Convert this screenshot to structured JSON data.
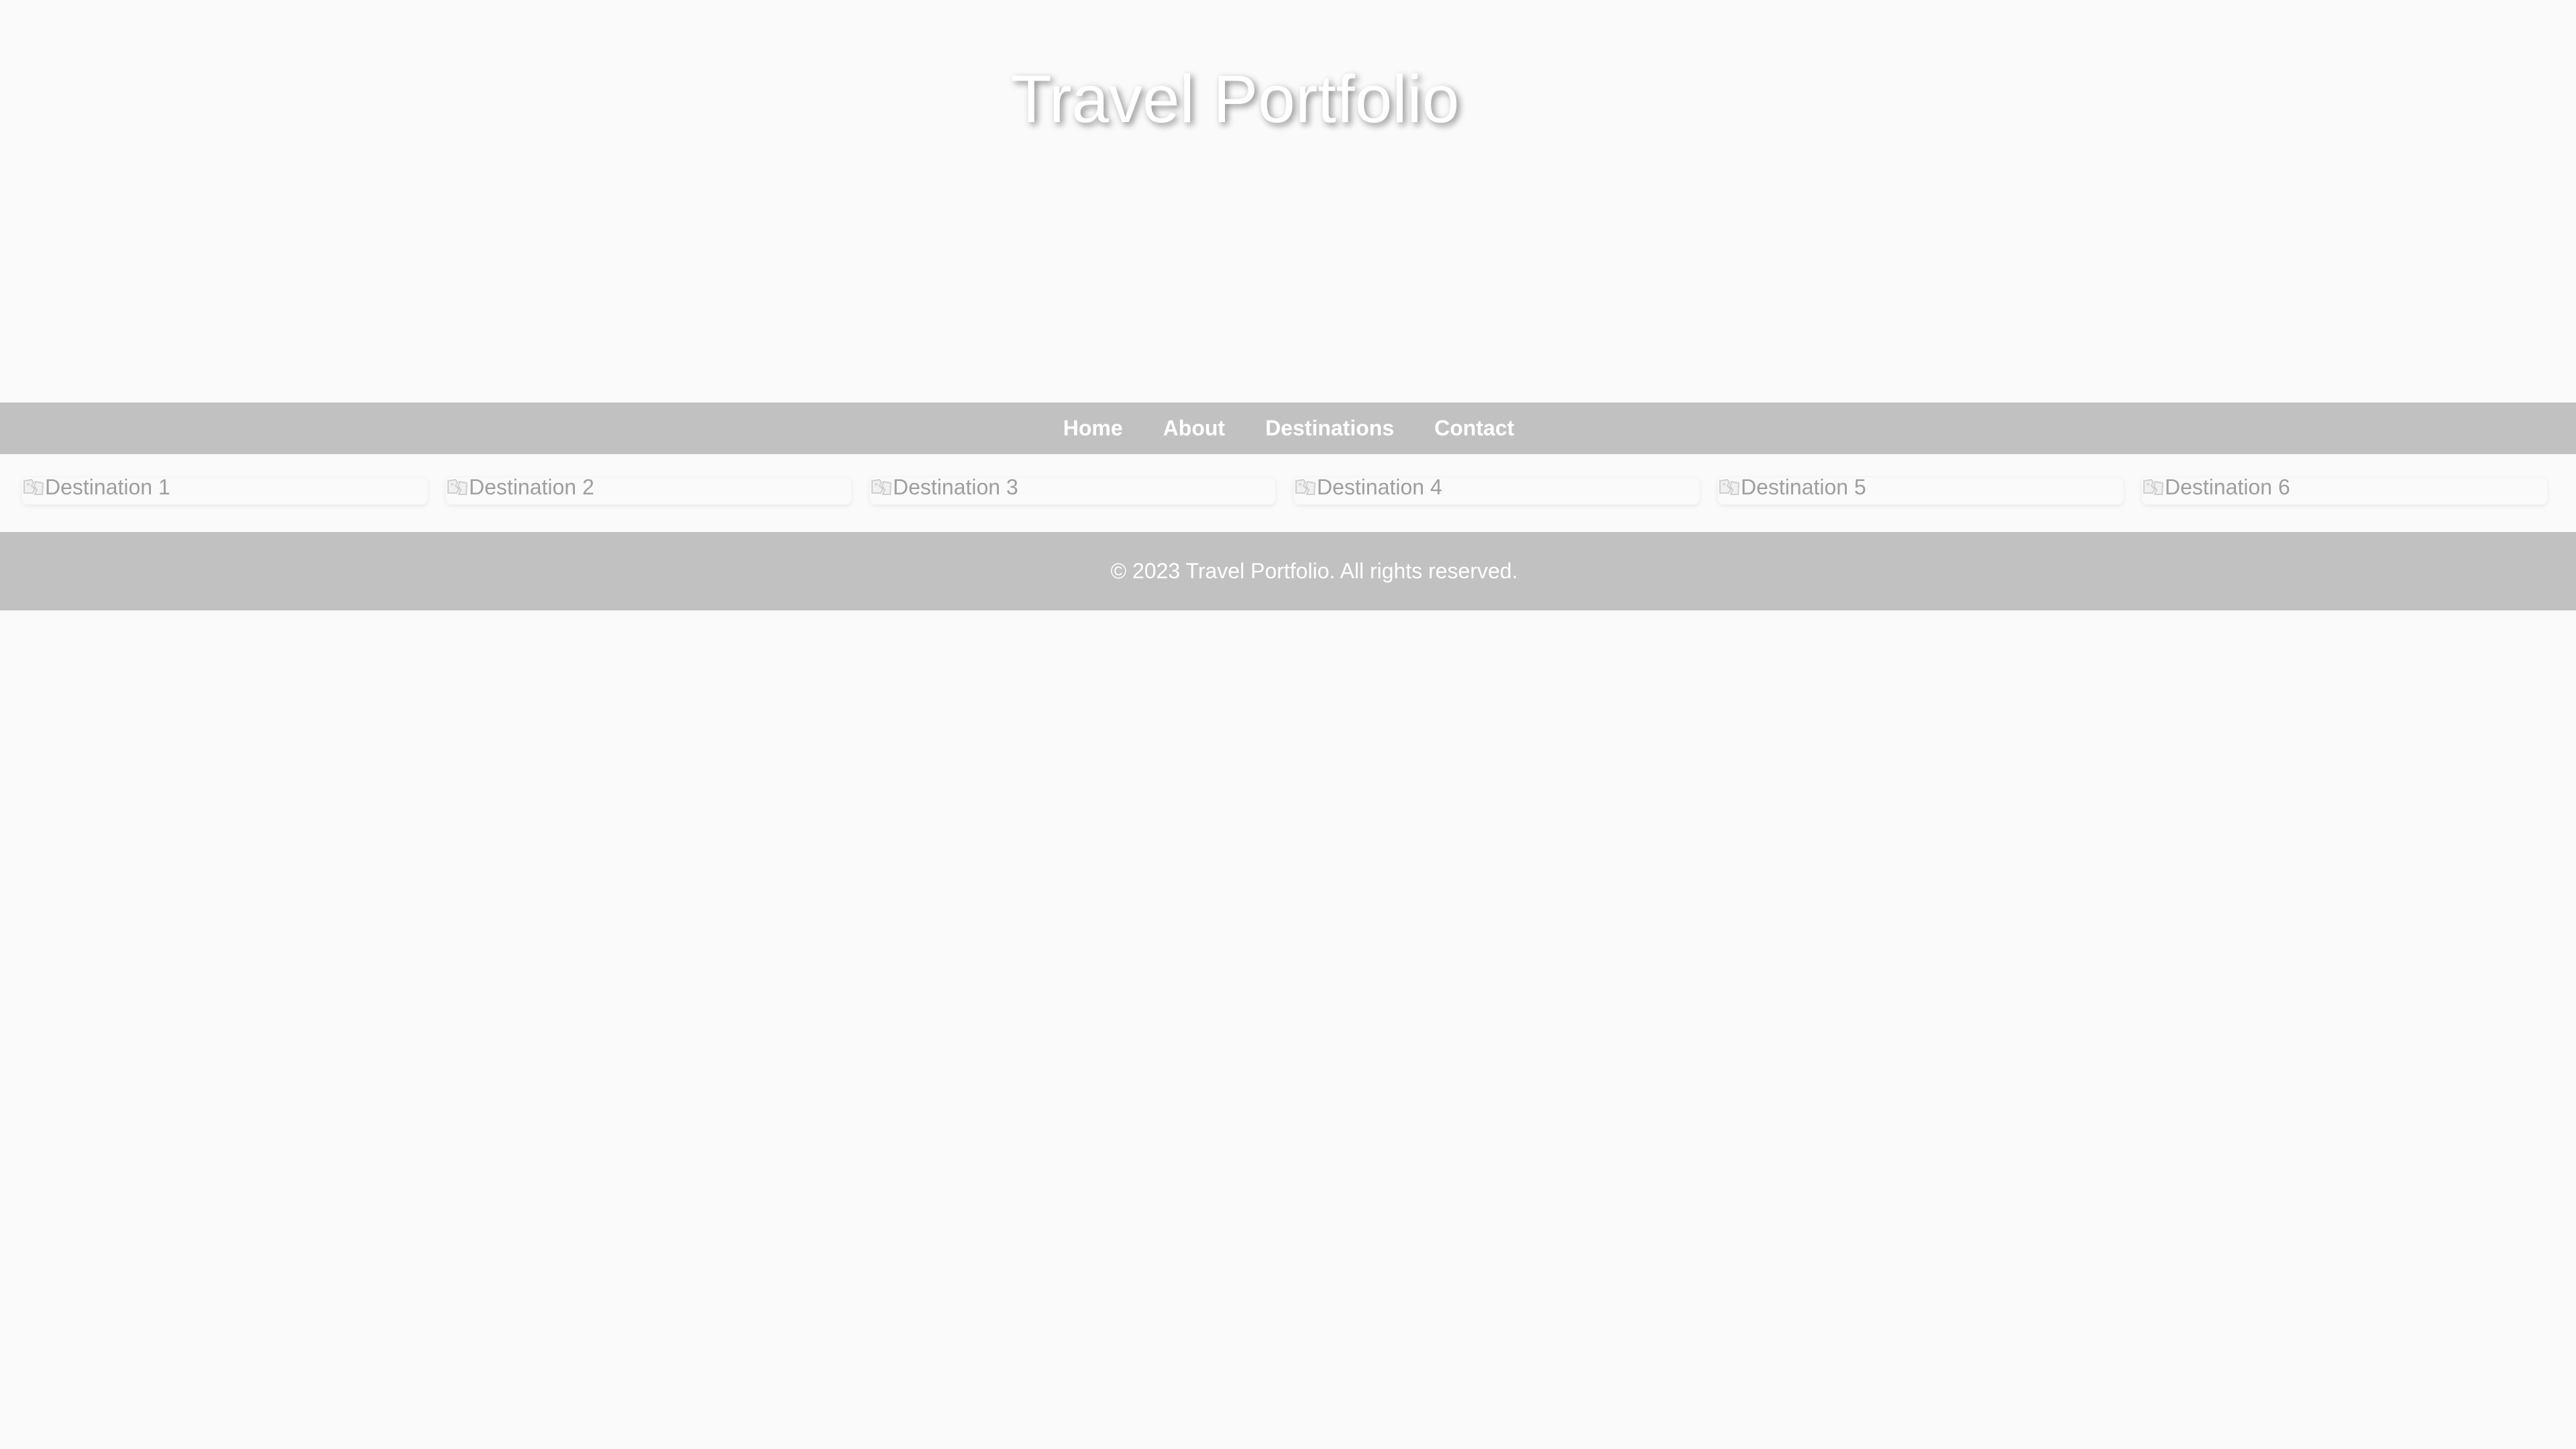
{
  "header": {
    "title": "Travel Portfolio"
  },
  "nav": {
    "items": [
      {
        "label": "Home"
      },
      {
        "label": "About"
      },
      {
        "label": "Destinations"
      },
      {
        "label": "Contact"
      }
    ]
  },
  "gallery": {
    "items": [
      {
        "alt": "Destination 1",
        "icon": "broken-image-icon"
      },
      {
        "alt": "Destination 2",
        "icon": "broken-image-icon"
      },
      {
        "alt": "Destination 3",
        "icon": "broken-image-icon"
      },
      {
        "alt": "Destination 4",
        "icon": "broken-image-icon"
      },
      {
        "alt": "Destination 5",
        "icon": "broken-image-icon"
      },
      {
        "alt": "Destination 6",
        "icon": "broken-image-icon"
      }
    ]
  },
  "footer": {
    "text": "© 2023 Travel Portfolio. All rights reserved."
  },
  "colors": {
    "background": "#fafafa",
    "bar": "#c1c1c1",
    "text_light": "#ffffff",
    "alt_text": "#9e9e9e"
  }
}
